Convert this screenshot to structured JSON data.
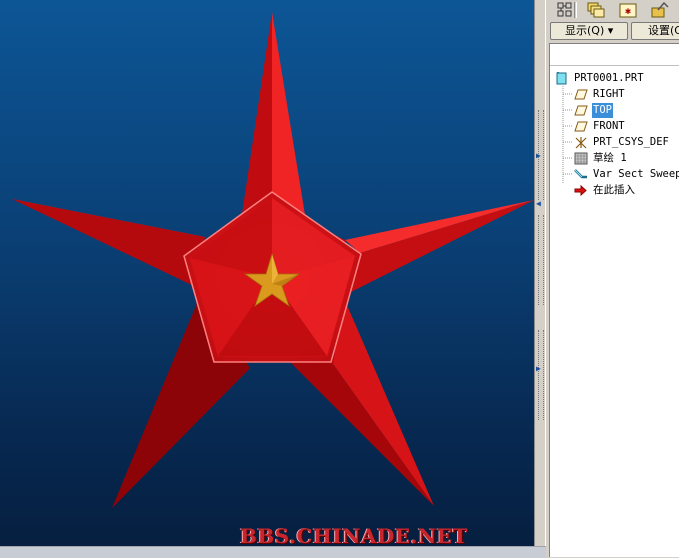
{
  "viewport": {
    "watermark": "BBS.CHINADE.NET"
  },
  "toolbar": {
    "icons": [
      "model-tree-icon",
      "layers-icon",
      "favorites-icon",
      "navigator-icon"
    ]
  },
  "dropdowns": {
    "show_label": "显示(Q) ▾",
    "settings_label": "设置(G)"
  },
  "tree": {
    "items": [
      {
        "label": "PRT0001.PRT",
        "icon": "part-icon",
        "selected": false
      },
      {
        "label": "RIGHT",
        "icon": "datum-plane-icon",
        "selected": false
      },
      {
        "label": "TOP",
        "icon": "datum-plane-icon",
        "selected": true
      },
      {
        "label": "FRONT",
        "icon": "datum-plane-icon",
        "selected": false
      },
      {
        "label": "PRT_CSYS_DEF",
        "icon": "coordinate-system-icon",
        "selected": false
      },
      {
        "label": "草绘 1",
        "icon": "sketch-icon",
        "selected": false
      },
      {
        "label": "Var Sect Sweep",
        "icon": "sweep-feature-icon",
        "selected": false
      },
      {
        "label": "在此插入",
        "icon": "insert-here-arrow-icon",
        "selected": false
      }
    ]
  },
  "colors": {
    "star_red": "#d4141a",
    "star_dark": "#7c0208",
    "small_star_gold": "#d99a1e",
    "selection_blue": "#3a8fd8"
  }
}
